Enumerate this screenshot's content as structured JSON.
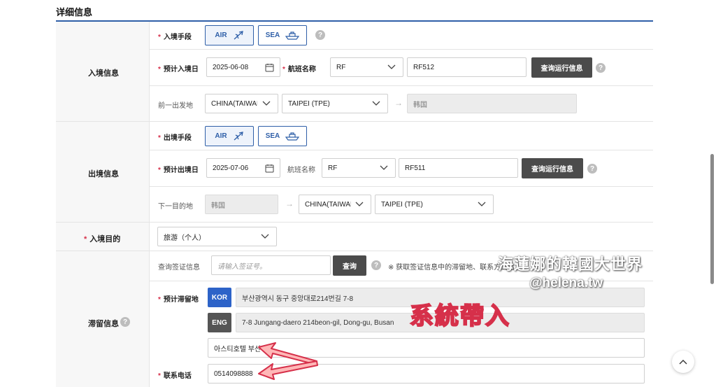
{
  "section_title": "详细信息",
  "entry": {
    "group_label": "入境信息",
    "mode_label": "入境手段",
    "mode_air": "AIR",
    "mode_sea": "SEA",
    "date_label": "预计入境日",
    "date_value": "2025-06-08",
    "flight_label": "航班名称",
    "airline_value": "RF",
    "flight_value": "RF512",
    "query_button": "查询运行信息",
    "origin_label": "前一出发地",
    "origin_country": "CHINA(TAIWAN)",
    "origin_city": "TAIPEI (TPE)",
    "destination": "韩国"
  },
  "exit": {
    "group_label": "出境信息",
    "mode_label": "出境手段",
    "mode_air": "AIR",
    "mode_sea": "SEA",
    "date_label": "预计出境日",
    "date_value": "2025-07-06",
    "flight_label": "航班名称",
    "airline_value": "RF",
    "flight_value": "RF511",
    "query_button": "查询运行信息",
    "next_label": "下一目的地",
    "from_value": "韩国",
    "dest_country": "CHINA(TAIWAN)",
    "dest_city": "TAIPEI (TPE)"
  },
  "purpose": {
    "label": "入境目的",
    "value": "旅游（个人）"
  },
  "stay": {
    "group_label": "滞留信息",
    "visa_label": "查询签证信息",
    "visa_placeholder": "请输入签证号。",
    "visa_button": "查询",
    "visa_note": "※ 获取签证信息中的滞留地、联系方式信息",
    "address_label": "预计滞留地",
    "kor_badge": "KOR",
    "kor_address": "부산광역시 동구 중앙대로214번길 7-8",
    "eng_badge": "ENG",
    "eng_address": "7-8 Jungang-daero 214beon-gil, Dong-gu, Busan",
    "hotel_name": "아스티호텔 부산",
    "phone_label": "联系电话",
    "phone_value": "0514098888"
  },
  "overlay": {
    "watermark_name": "海蓮娜的韓國大世界",
    "watermark_handle": "@helena.tw",
    "annotation": "系統帶入"
  },
  "colors": {
    "accent": "#2f5fa8",
    "required": "#d6304a",
    "kor_badge": "#2d63c8",
    "dark_button": "#4b4b4b",
    "annotation": "#ffb7b7"
  }
}
